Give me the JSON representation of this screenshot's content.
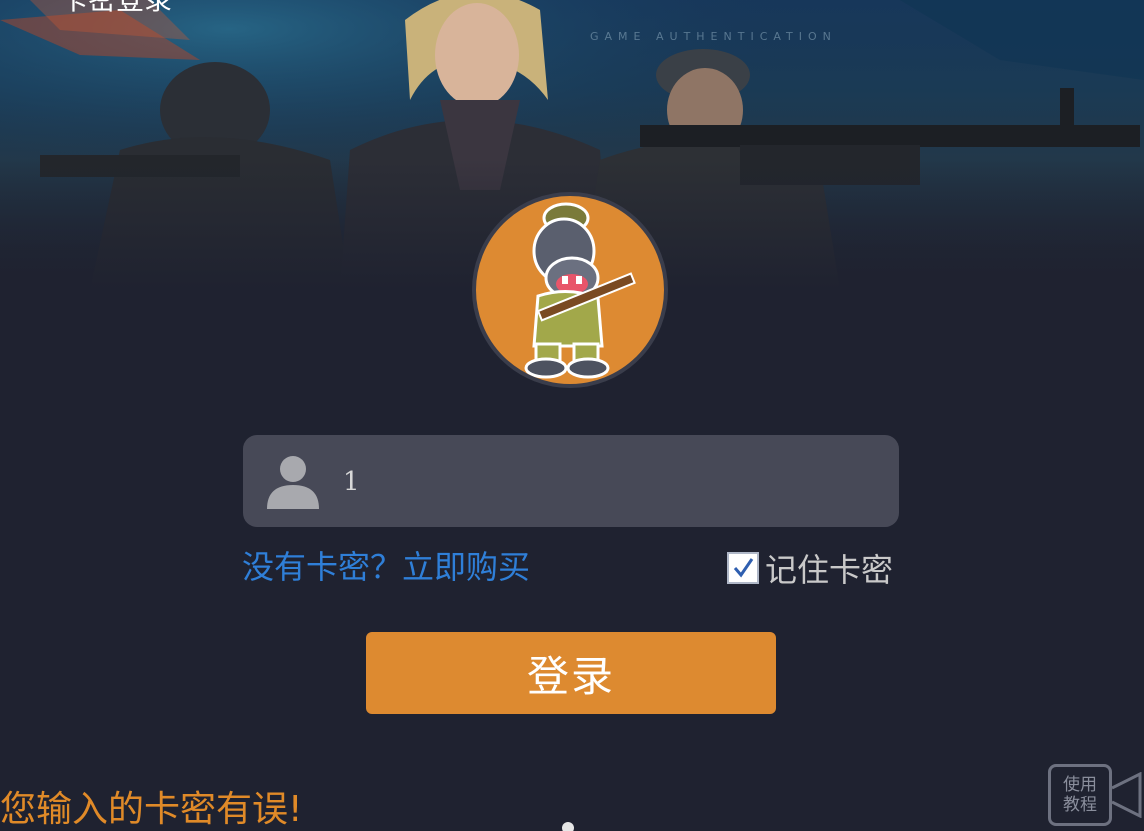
{
  "window": {
    "title": "卡密登录",
    "banner_caption": "GAME AUTHENTICATION"
  },
  "avatar": {
    "icon": "hippo-soldier-avatar"
  },
  "login": {
    "card_key_value": "1",
    "card_key_icon": "user-icon",
    "buy_link_label": "没有卡密？立即购买",
    "remember_label": "记住卡密",
    "remember_checked": true,
    "login_button_label": "登录"
  },
  "status": {
    "error_message": "您输入的卡密有误!"
  },
  "tutorial": {
    "line1": "使用",
    "line2": "教程",
    "icon": "video-camera-icon"
  },
  "colors": {
    "background": "#1f2230",
    "accent": "#dd8a30",
    "link": "#2f7fd8",
    "error": "#e08a28",
    "input_bg": "#474957"
  }
}
